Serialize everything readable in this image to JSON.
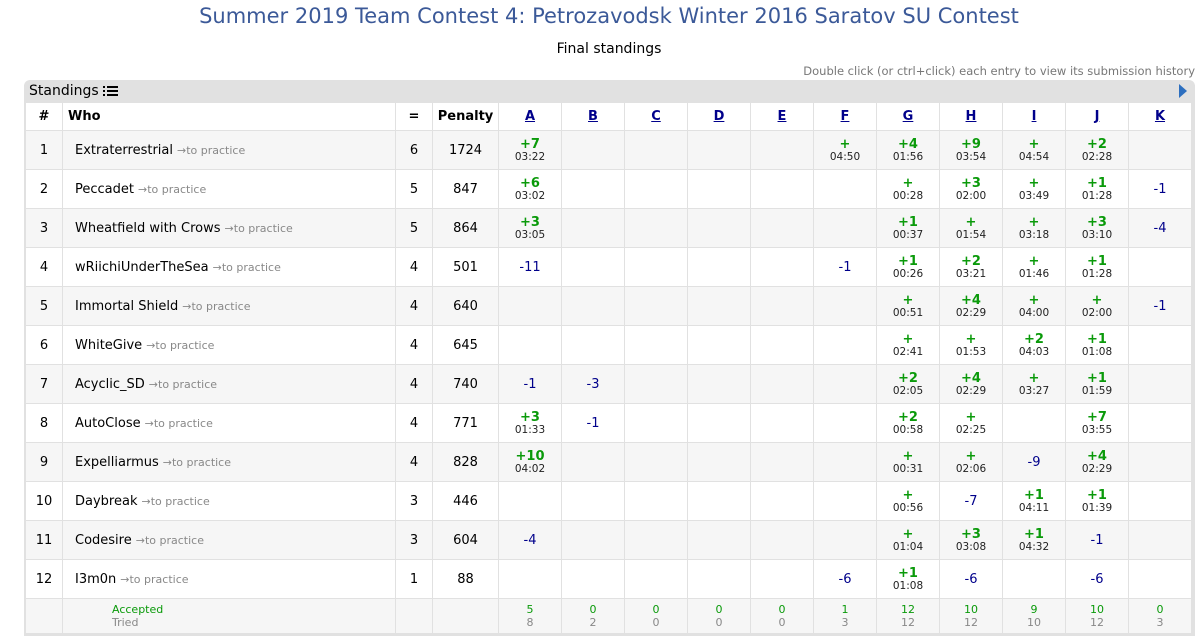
{
  "header": {
    "title": "Summer 2019 Team Contest 4: Petrozavodsk Winter 2016 Saratov SU Contest",
    "subtitle": "Final standings",
    "hint": "Double click (or ctrl+click) each entry to view its submission history"
  },
  "panel": {
    "label": "Standings"
  },
  "columns": {
    "rank": "#",
    "who": "Who",
    "solved": "=",
    "penalty": "Penalty"
  },
  "problems": [
    "A",
    "B",
    "C",
    "D",
    "E",
    "F",
    "G",
    "H",
    "I",
    "J",
    "K"
  ],
  "practice_label": "→to practice",
  "rows": [
    {
      "rank": "1",
      "name": "Extraterrestrial",
      "solved": "6",
      "penalty": "1724",
      "cells": [
        [
          "+7",
          "03:22"
        ],
        [],
        [],
        [],
        [],
        [
          "+",
          "04:50"
        ],
        [
          "+4",
          "01:56"
        ],
        [
          "+9",
          "03:54"
        ],
        [
          "+",
          "04:54"
        ],
        [
          "+2",
          "02:28"
        ],
        []
      ]
    },
    {
      "rank": "2",
      "name": "Peccadet",
      "solved": "5",
      "penalty": "847",
      "cells": [
        [
          "+6",
          "03:02"
        ],
        [],
        [],
        [],
        [],
        [],
        [
          "+",
          "00:28"
        ],
        [
          "+3",
          "02:00"
        ],
        [
          "+",
          "03:49"
        ],
        [
          "+1",
          "01:28"
        ],
        [
          "-1"
        ]
      ]
    },
    {
      "rank": "3",
      "name": "Wheatfield with Crows",
      "solved": "5",
      "penalty": "864",
      "cells": [
        [
          "+3",
          "03:05"
        ],
        [],
        [],
        [],
        [],
        [],
        [
          "+1",
          "00:37"
        ],
        [
          "+",
          "01:54"
        ],
        [
          "+",
          "03:18"
        ],
        [
          "+3",
          "03:10"
        ],
        [
          "-4"
        ]
      ]
    },
    {
      "rank": "4",
      "name": "wRiichiUnderTheSea",
      "solved": "4",
      "penalty": "501",
      "cells": [
        [
          "-11"
        ],
        [],
        [],
        [],
        [],
        [
          "-1"
        ],
        [
          "+1",
          "00:26"
        ],
        [
          "+2",
          "03:21"
        ],
        [
          "+",
          "01:46"
        ],
        [
          "+1",
          "01:28"
        ],
        []
      ]
    },
    {
      "rank": "5",
      "name": "Immortal Shield",
      "solved": "4",
      "penalty": "640",
      "cells": [
        [],
        [],
        [],
        [],
        [],
        [],
        [
          "+",
          "00:51"
        ],
        [
          "+4",
          "02:29"
        ],
        [
          "+",
          "04:00"
        ],
        [
          "+",
          "02:00"
        ],
        [
          "-1"
        ]
      ]
    },
    {
      "rank": "6",
      "name": "WhiteGive",
      "solved": "4",
      "penalty": "645",
      "cells": [
        [],
        [],
        [],
        [],
        [],
        [],
        [
          "+",
          "02:41"
        ],
        [
          "+",
          "01:53"
        ],
        [
          "+2",
          "04:03"
        ],
        [
          "+1",
          "01:08"
        ],
        []
      ]
    },
    {
      "rank": "7",
      "name": "Acyclic_SD",
      "solved": "4",
      "penalty": "740",
      "cells": [
        [
          "-1"
        ],
        [
          "-3"
        ],
        [],
        [],
        [],
        [],
        [
          "+2",
          "02:05"
        ],
        [
          "+4",
          "02:29"
        ],
        [
          "+",
          "03:27"
        ],
        [
          "+1",
          "01:59"
        ],
        []
      ]
    },
    {
      "rank": "8",
      "name": "AutoClose",
      "solved": "4",
      "penalty": "771",
      "cells": [
        [
          "+3",
          "01:33"
        ],
        [
          "-1"
        ],
        [],
        [],
        [],
        [],
        [
          "+2",
          "00:58"
        ],
        [
          "+",
          "02:25"
        ],
        [],
        [
          "+7",
          "03:55"
        ],
        []
      ]
    },
    {
      "rank": "9",
      "name": "Expelliarmus",
      "solved": "4",
      "penalty": "828",
      "cells": [
        [
          "+10",
          "04:02"
        ],
        [],
        [],
        [],
        [],
        [],
        [
          "+",
          "00:31"
        ],
        [
          "+",
          "02:06"
        ],
        [
          "-9"
        ],
        [
          "+4",
          "02:29"
        ],
        []
      ]
    },
    {
      "rank": "10",
      "name": "Daybreak",
      "solved": "3",
      "penalty": "446",
      "cells": [
        [],
        [],
        [],
        [],
        [],
        [],
        [
          "+",
          "00:56"
        ],
        [
          "-7"
        ],
        [
          "+1",
          "04:11"
        ],
        [
          "+1",
          "01:39"
        ],
        []
      ]
    },
    {
      "rank": "11",
      "name": "Codesire",
      "solved": "3",
      "penalty": "604",
      "cells": [
        [
          "-4"
        ],
        [],
        [],
        [],
        [],
        [],
        [
          "+",
          "01:04"
        ],
        [
          "+3",
          "03:08"
        ],
        [
          "+1",
          "04:32"
        ],
        [
          "-1"
        ],
        []
      ]
    },
    {
      "rank": "12",
      "name": "I3m0n",
      "solved": "1",
      "penalty": "88",
      "cells": [
        [],
        [],
        [],
        [],
        [],
        [
          "-6"
        ],
        [
          "+1",
          "01:08"
        ],
        [
          "-6"
        ],
        [],
        [
          "-6"
        ],
        []
      ]
    }
  ],
  "footer": {
    "accepted_label": "Accepted",
    "tried_label": "Tried",
    "accepted": [
      "5",
      "0",
      "0",
      "0",
      "0",
      "1",
      "12",
      "10",
      "9",
      "10",
      "0"
    ],
    "tried": [
      "8",
      "2",
      "0",
      "0",
      "0",
      "3",
      "12",
      "12",
      "10",
      "12",
      "3"
    ]
  }
}
